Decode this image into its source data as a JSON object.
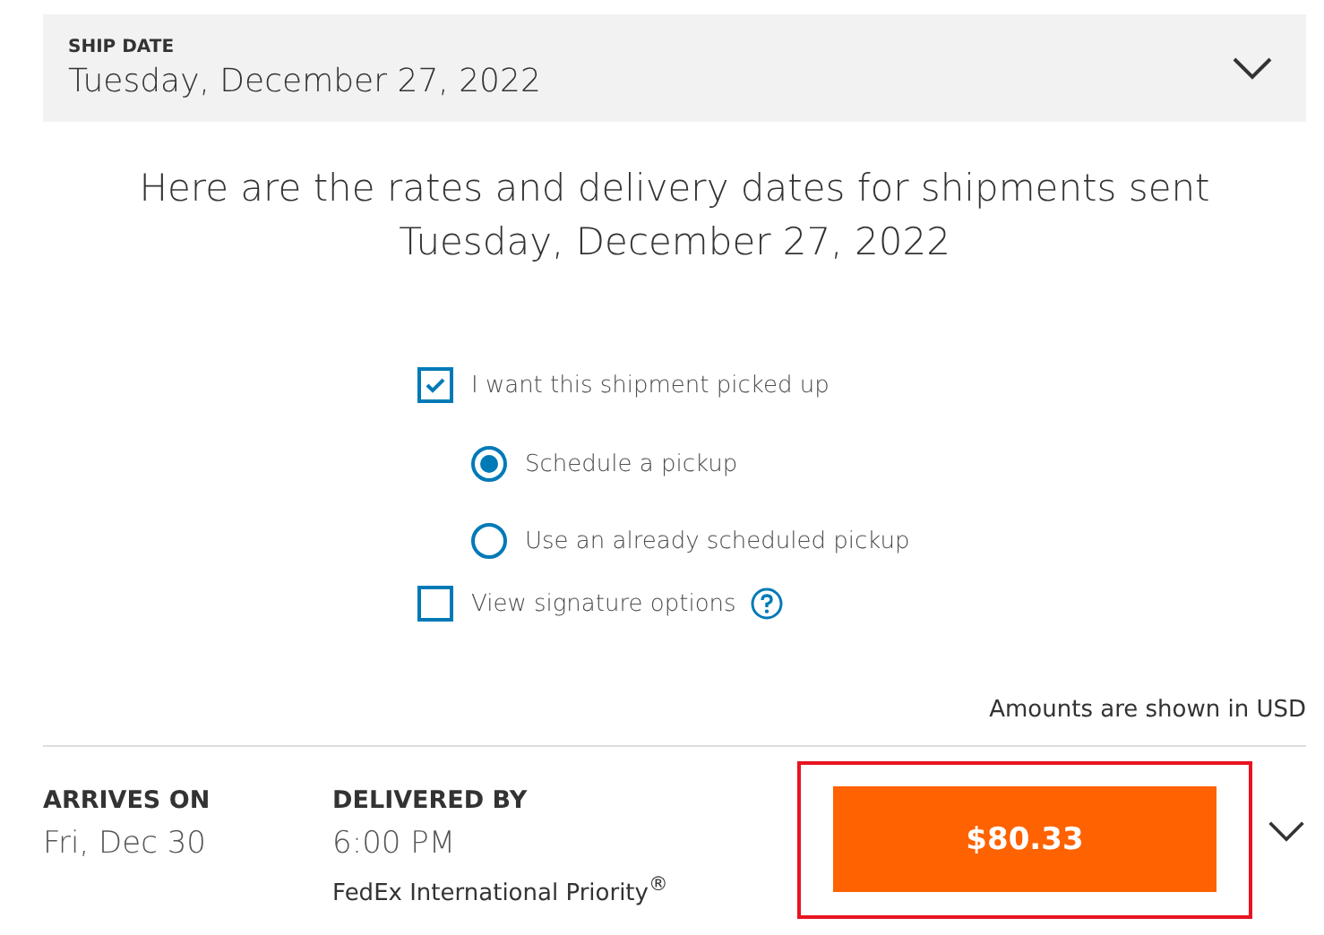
{
  "ship_date": {
    "label": "SHIP DATE",
    "value": "Tuesday, December 27, 2022",
    "expanded": false
  },
  "heading": [
    "Here are the rates and delivery dates for shipments sent",
    "Tuesday, December 27, 2022"
  ],
  "options": [
    {
      "kind": "checkbox",
      "label": "I want this shipment picked up",
      "checked": true,
      "help": false
    },
    {
      "kind": "radio",
      "label": "Schedule a pickup",
      "selected": true
    },
    {
      "kind": "radio",
      "label": "Use an already scheduled pickup",
      "selected": false
    },
    {
      "kind": "checkbox",
      "label": "View signature options",
      "checked": false,
      "help": true
    }
  ],
  "currency_note": "Amounts are shown in USD",
  "rate": {
    "arrives_label": "ARRIVES ON",
    "arrives": "Fri, Dec 30",
    "delivered_label": "DELIVERED BY",
    "delivered": "6:00 PM",
    "service": "FedEx International Priority$^{®}$",
    "price": "$80.33",
    "highlighted": true,
    "expanded": false
  }
}
